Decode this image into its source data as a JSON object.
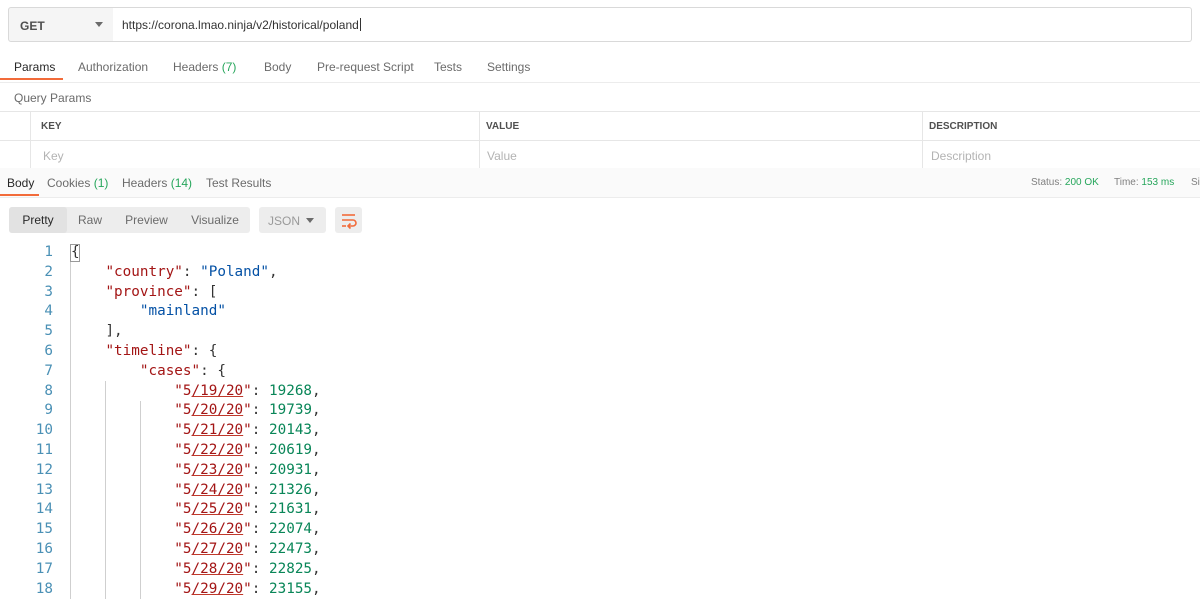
{
  "request": {
    "method": "GET",
    "url": "https://corona.lmao.ninja/v2/historical/poland"
  },
  "request_tabs": [
    {
      "label": "Params",
      "count": ""
    },
    {
      "label": "Authorization",
      "count": ""
    },
    {
      "label": "Headers",
      "count": "(7)"
    },
    {
      "label": "Body",
      "count": ""
    },
    {
      "label": "Pre-request Script",
      "count": ""
    },
    {
      "label": "Tests",
      "count": ""
    },
    {
      "label": "Settings",
      "count": ""
    }
  ],
  "query_params": {
    "title": "Query Params",
    "columns": [
      "KEY",
      "VALUE",
      "DESCRIPTION"
    ],
    "placeholders": [
      "Key",
      "Value",
      "Description"
    ]
  },
  "response_tabs": [
    {
      "label": "Body",
      "count": ""
    },
    {
      "label": "Cookies",
      "count": "(1)"
    },
    {
      "label": "Headers",
      "count": "(14)"
    },
    {
      "label": "Test Results",
      "count": ""
    }
  ],
  "status": {
    "status_label": "Status:",
    "status_value": "200 OK",
    "time_label": "Time:",
    "time_value": "153 ms",
    "size_label": "Si"
  },
  "view_modes": [
    "Pretty",
    "Raw",
    "Preview",
    "Visualize"
  ],
  "format": "JSON",
  "icons": {
    "method_dropdown": "chevron-down-icon",
    "format_dropdown": "chevron-down-icon",
    "wrap": "wrap-lines-icon"
  },
  "colors": {
    "accent": "#f26b3a",
    "success": "#26a65b",
    "json_key": "#a31515",
    "json_string": "#0451a5",
    "json_number": "#098658",
    "line_number": "#4a90b5"
  },
  "code_lines": [
    {
      "num": "1",
      "text": "{"
    },
    {
      "num": "2",
      "text": "    \"country\": \"Poland\","
    },
    {
      "num": "3",
      "text": "    \"province\": ["
    },
    {
      "num": "4",
      "text": "        \"mainland\""
    },
    {
      "num": "5",
      "text": "    ],"
    },
    {
      "num": "6",
      "text": "    \"timeline\": {"
    },
    {
      "num": "7",
      "text": "        \"cases\": {"
    },
    {
      "num": "8",
      "text": "            \"5/19/20\": 19268,"
    },
    {
      "num": "9",
      "text": "            \"5/20/20\": 19739,"
    },
    {
      "num": "10",
      "text": "            \"5/21/20\": 20143,"
    },
    {
      "num": "11",
      "text": "            \"5/22/20\": 20619,"
    },
    {
      "num": "12",
      "text": "            \"5/23/20\": 20931,"
    },
    {
      "num": "13",
      "text": "            \"5/24/20\": 21326,"
    },
    {
      "num": "14",
      "text": "            \"5/25/20\": 21631,"
    },
    {
      "num": "15",
      "text": "            \"5/26/20\": 22074,"
    },
    {
      "num": "16",
      "text": "            \"5/27/20\": 22473,"
    },
    {
      "num": "17",
      "text": "            \"5/28/20\": 22825,"
    },
    {
      "num": "18",
      "text": "            \"5/29/20\": 23155,"
    }
  ]
}
